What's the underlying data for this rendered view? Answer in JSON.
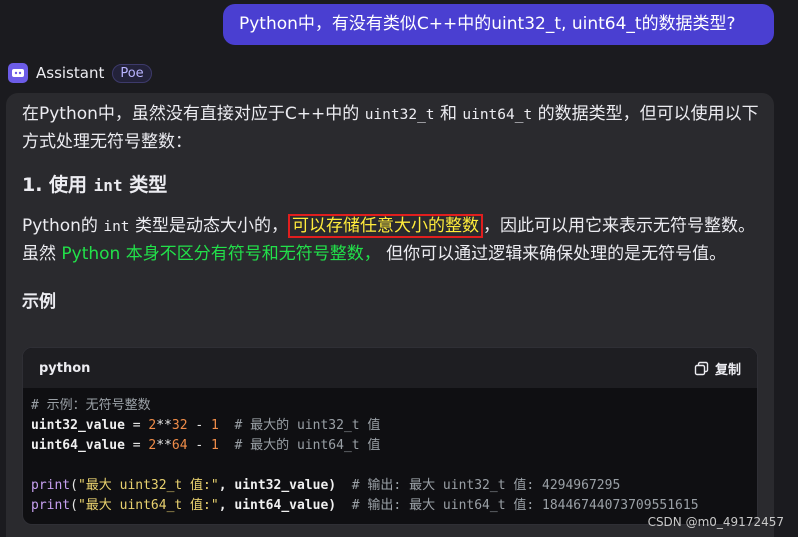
{
  "user_message": "Python中，有没有类似C++中的uint32_t, uint64_t的数据类型?",
  "assistant": {
    "name": "Assistant",
    "badge": "Poe"
  },
  "answer": {
    "intro_a": "在Python中，虽然没有直接对应于C++中的 ",
    "intro_code1": "uint32_t",
    "intro_b": " 和 ",
    "intro_code2": "uint64_t",
    "intro_c": " 的数据类型，但可以使用以下方式处理无符号整数：",
    "section1_prefix": "1. 使用 ",
    "section1_code": "int",
    "section1_suffix": " 类型",
    "p2_a": "Python的 ",
    "p2_code": "int",
    "p2_b": " 类型是动态大小的，",
    "p2_highlight_red": "可以存储任意大小的整数",
    "p2_c": "，因此可以用它来表示无符号整数。虽然 ",
    "p2_highlight_green": "Python 本身不区分有符号和无符号整数，",
    "p2_d": " 但你可以通过逻辑来确保处理的是无符号值。",
    "example_heading": "示例"
  },
  "code_block": {
    "language": "python",
    "copy_label": "复制",
    "lines": {
      "l1_comment": "# 示例：无符号整数",
      "l2_var": "uint32_value",
      "l2_op": " = ",
      "l2_n1": "2",
      "l2_pow": "**",
      "l2_n2": "32",
      "l2_minus": " - ",
      "l2_n3": "1",
      "l2_comment": "  # 最大的 uint32_t 值",
      "l3_var": "uint64_value",
      "l3_op": " = ",
      "l3_n1": "2",
      "l3_pow": "**",
      "l3_n2": "64",
      "l3_minus": " - ",
      "l3_n3": "1",
      "l3_comment": "  # 最大的 uint64_t 值",
      "l5_fn": "print",
      "l5_open": "(",
      "l5_str": "\"最大 uint32_t 值:\"",
      "l5_rest": ", uint32_value)",
      "l5_comment": "  # 输出: 最大 uint32_t 值: 4294967295",
      "l6_fn": "print",
      "l6_open": "(",
      "l6_str": "\"最大 uint64_t 值:\"",
      "l6_rest": ", uint64_value)",
      "l6_comment": "  # 输出: 最大 uint64_t 值: 18446744073709551615"
    }
  },
  "watermark": "CSDN @m0_49172457",
  "colors": {
    "user_bubble": "#4a3fd1",
    "card_bg": "#2a2a2e",
    "highlight_red_border": "#e01e1e",
    "highlight_yellow_text": "#ffeb3b",
    "highlight_green_text": "#22e04a"
  }
}
